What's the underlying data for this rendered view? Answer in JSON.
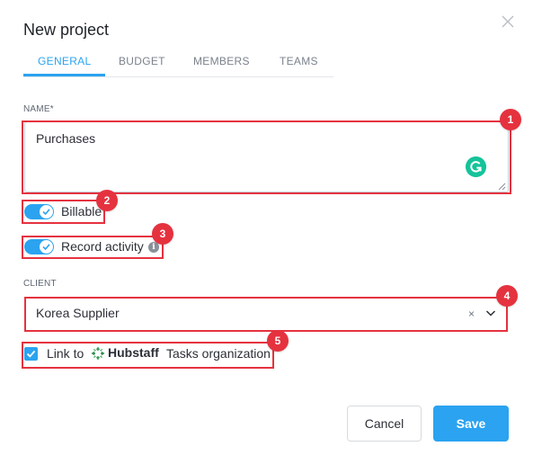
{
  "dialog": {
    "title": "New project"
  },
  "tabs": [
    {
      "label": "GENERAL",
      "active": true
    },
    {
      "label": "BUDGET",
      "active": false
    },
    {
      "label": "MEMBERS",
      "active": false
    },
    {
      "label": "TEAMS",
      "active": false
    }
  ],
  "name_field": {
    "label": "NAME*",
    "value": "Purchases"
  },
  "billable": {
    "label": "Billable",
    "on": true
  },
  "record_activity": {
    "label": "Record activity",
    "on": true,
    "info_icon": "info-icon"
  },
  "client_field": {
    "label": "CLIENT",
    "value": "Korea Supplier",
    "clear_symbol": "×"
  },
  "link_option": {
    "prefix": "Link to",
    "brand": "Hubstaff",
    "suffix": "Tasks organization",
    "checked": true
  },
  "annotations": [
    "1",
    "2",
    "3",
    "4",
    "5"
  ],
  "buttons": {
    "cancel": "Cancel",
    "save": "Save"
  },
  "colors": {
    "accent": "#2ba3f0",
    "annotation": "#e5323f",
    "grammarly": "#15c39a"
  }
}
